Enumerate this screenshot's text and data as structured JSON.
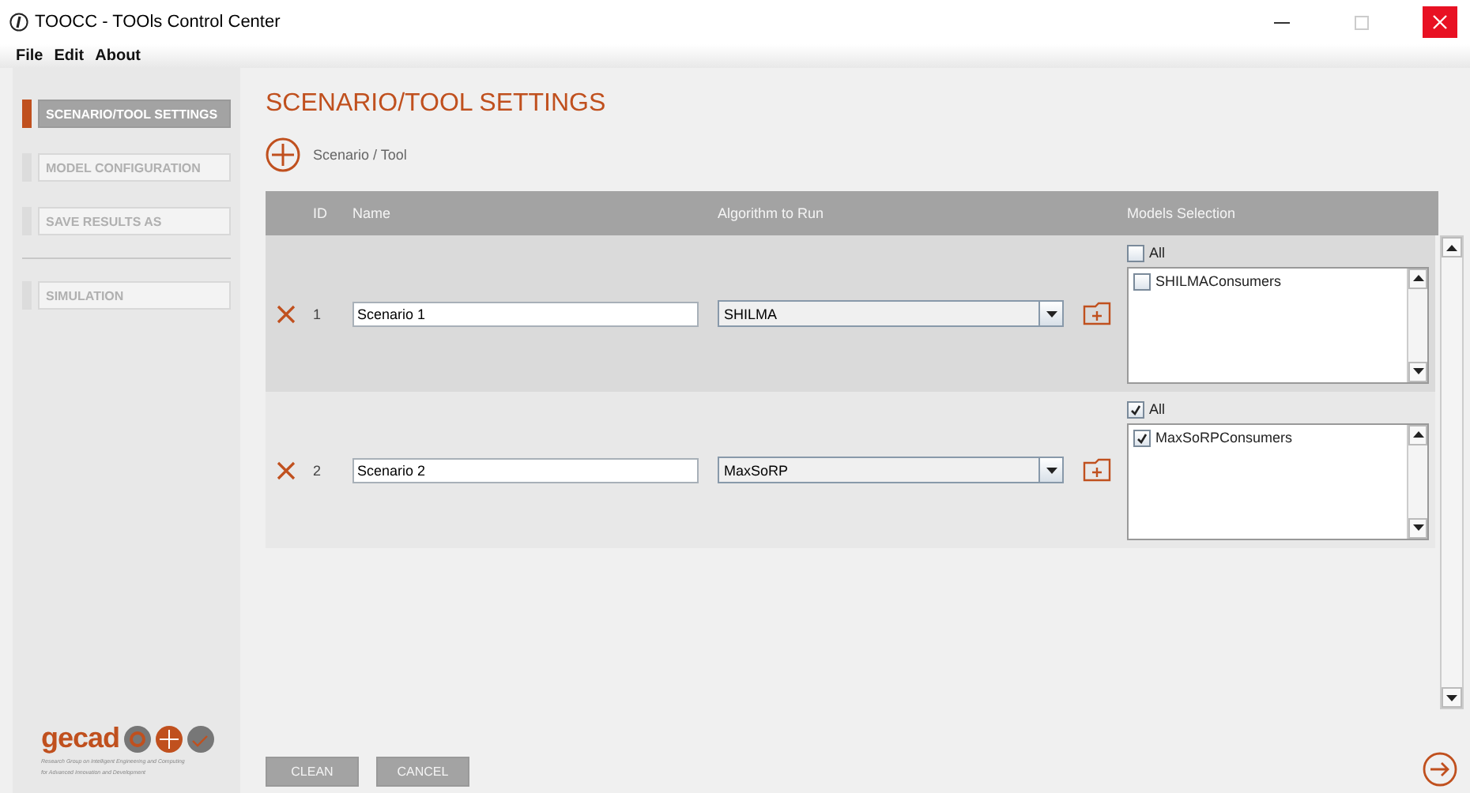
{
  "window": {
    "title": "TOOCC - TOOls Control Center"
  },
  "menu": [
    "File",
    "Edit",
    "About"
  ],
  "sidebar": {
    "groups": [
      [
        {
          "label": "SCENARIO/TOOL SETTINGS",
          "selected": true
        },
        {
          "label": "MODEL CONFIGURATION",
          "selected": false
        },
        {
          "label": "SAVE RESULTS AS",
          "selected": false
        }
      ],
      [
        {
          "label": "SIMULATION",
          "selected": false
        }
      ]
    ]
  },
  "logo": {
    "name": "gecad",
    "tagline": [
      "Research Group on Intelligent Engineering and Computing",
      "for Advanced Innovation and Development"
    ]
  },
  "page_title": "SCENARIO/TOOL SETTINGS",
  "add_label": "Scenario / Tool",
  "table": {
    "columns": [
      "ID",
      "Name",
      "Algorithm to Run",
      "Models Selection"
    ],
    "rows": [
      {
        "id": "1",
        "name": "Scenario 1",
        "algorithm": "SHILMA",
        "all_checked": false,
        "all_label": "All",
        "models": [
          {
            "label": "SHILMAConsumers",
            "checked": false
          }
        ]
      },
      {
        "id": "2",
        "name": "Scenario 2",
        "algorithm": "MaxSoRP",
        "all_checked": true,
        "all_label": "All",
        "models": [
          {
            "label": "MaxSoRPConsumers",
            "checked": true
          }
        ]
      }
    ]
  },
  "buttons": [
    "CLEAN",
    "CANCEL"
  ]
}
